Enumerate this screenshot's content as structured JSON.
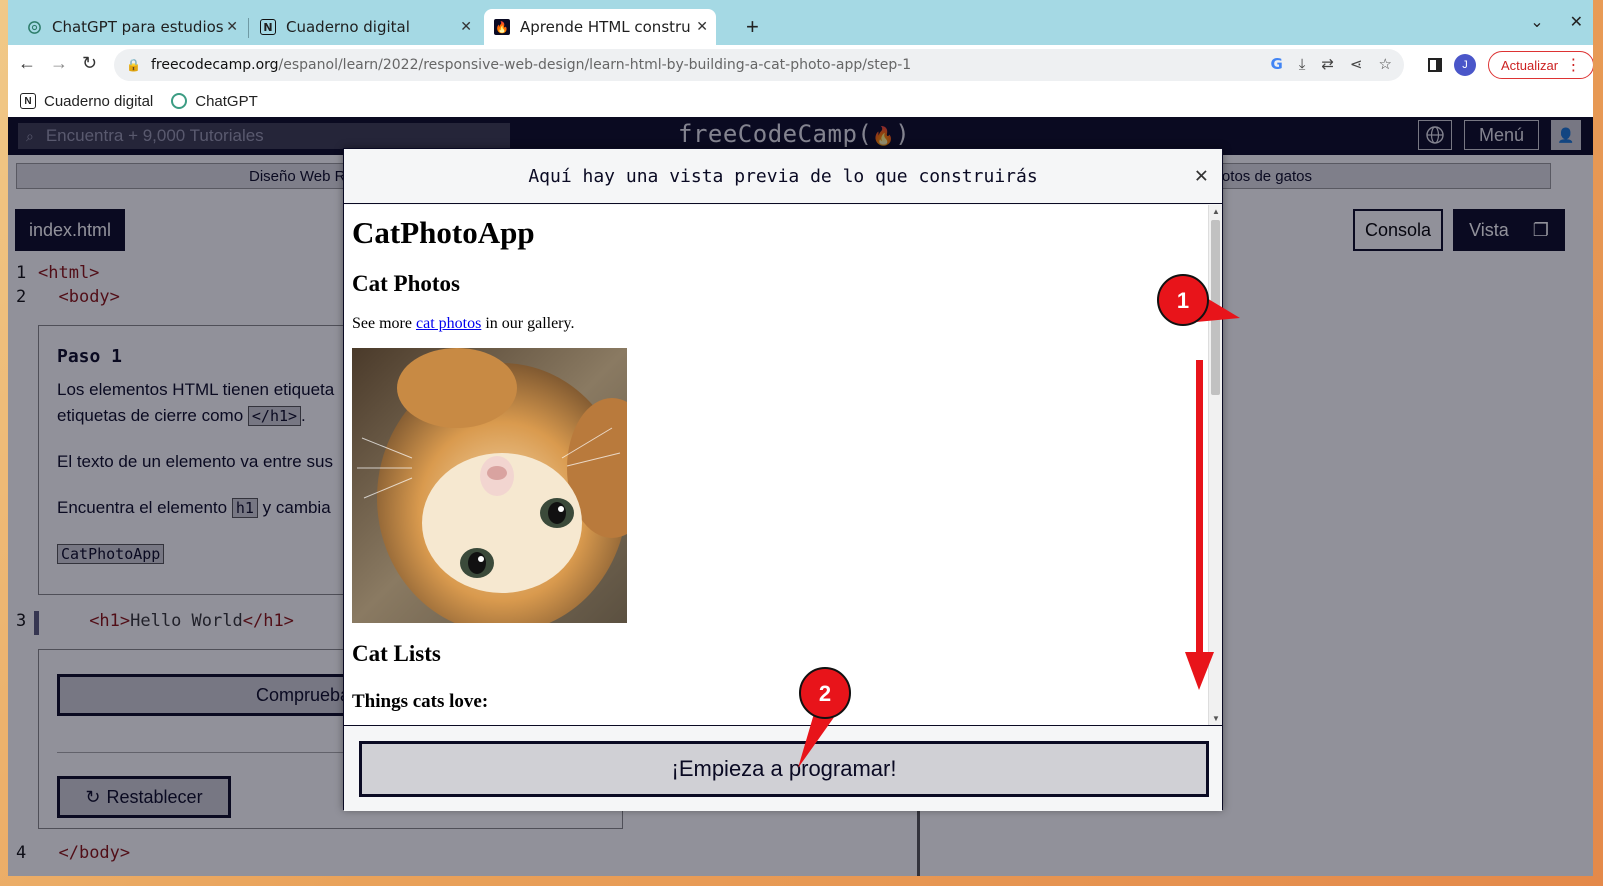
{
  "browser": {
    "tabs": [
      {
        "label": "ChatGPT para estudios",
        "icon": "chatgpt-icon"
      },
      {
        "label": "Cuaderno digital",
        "icon": "notion-icon"
      },
      {
        "label": "Aprende HTML construyendo",
        "icon": "freecodecamp-icon"
      }
    ],
    "url_host": "freecodecamp.org",
    "url_path": "/espanol/learn/2022/responsive-web-design/learn-html-by-building-a-cat-photo-app/step-1",
    "profile_initial": "J",
    "update_label": "Actualizar"
  },
  "bookmarks": [
    {
      "label": "Cuaderno digital",
      "icon": "notion-icon"
    },
    {
      "label": "ChatGPT",
      "icon": "chatgpt-icon"
    }
  ],
  "fcc": {
    "search_placeholder": "Encuentra + 9,000 Tutoriales",
    "logo": "freeCodeCamp(🔥)",
    "logo_text": "freeCodeCamp(",
    "logo_end": ")",
    "menu_label": "Menú",
    "breadcrumb_left": "Diseño Web R",
    "breadcrumb_right": "fotos de gatos",
    "editor_tab": "index.html",
    "console_label": "Consola",
    "preview_label": "Vista"
  },
  "editor": {
    "line1": "<html>",
    "line2": "<body>",
    "line3_open": "<h1>",
    "line3_text": "Hello World",
    "line3_close": "</h1>",
    "line4": "</body>",
    "step_title": "Paso 1",
    "para1a": "Los elementos HTML tienen etiqueta",
    "para1b": "etiquetas de cierre como",
    "para1_code": "</h1>",
    "para2": "El texto de un elemento va entre sus",
    "para3a": "Encuentra el elemento",
    "para3_code": "h1",
    "para3b": "y cambia",
    "code_block": "CatPhotoApp",
    "check_label": "Comprueba tu códi",
    "reset_label": "Restablecer"
  },
  "modal": {
    "title": "Aquí hay una vista previa de lo que construirás",
    "preview_h1": "CatPhotoApp",
    "preview_h2_photos": "Cat Photos",
    "preview_text_before": "See more",
    "preview_link": "cat photos",
    "preview_text_after": "in our gallery.",
    "preview_h2_lists": "Cat Lists",
    "preview_bold": "Things cats love:",
    "start_button": "¡Empieza a programar!"
  },
  "annotations": [
    {
      "label": "1"
    },
    {
      "label": "2"
    }
  ],
  "colors": {
    "fcc_dark": "#0a0a23",
    "annotation_red": "#e8141a",
    "tab_strip": "#a5d9e4"
  }
}
